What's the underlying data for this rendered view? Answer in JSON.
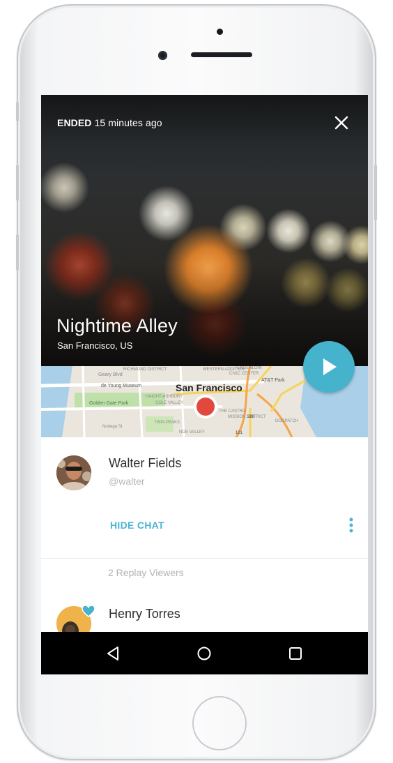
{
  "broadcast": {
    "status_label": "ENDED",
    "status_time": "15 minutes ago",
    "title": "Nightime Alley",
    "location": "San Francisco, US"
  },
  "map": {
    "city_label": "San Francisco",
    "labels": [
      "Geary Blvd",
      "RICHMOND DISTRICT",
      "de Young Museum",
      "Golden Gate Park",
      "HAIGHT-ASHBURY",
      "COLE VALLEY",
      "TWIN PEAKS",
      "NOE VALLEY",
      "Noriega St",
      "WESTERN ADDITION",
      "TENDERLOIN",
      "CIVIC CENTER",
      "AT&T Park",
      "THE CASTRO",
      "MISSION DISTRICT",
      "DOGPATCH",
      "101",
      "280"
    ],
    "marker_color": "#e2483d"
  },
  "user": {
    "name": "Walter Fields",
    "handle": "@walter"
  },
  "chat": {
    "hide_label": "HIDE CHAT"
  },
  "viewers": {
    "count_label": "2 Replay Viewers",
    "items": [
      {
        "name": "Henry Torres"
      }
    ]
  },
  "colors": {
    "accent": "#45b3cc",
    "link": "#4bb4d2",
    "marker": "#e2483d"
  },
  "icons": {
    "close": "close-icon",
    "play": "play-icon",
    "more": "more-vertical-icon",
    "heart": "heart-icon",
    "back": "back-icon",
    "home": "home-icon",
    "recents": "recents-icon"
  }
}
